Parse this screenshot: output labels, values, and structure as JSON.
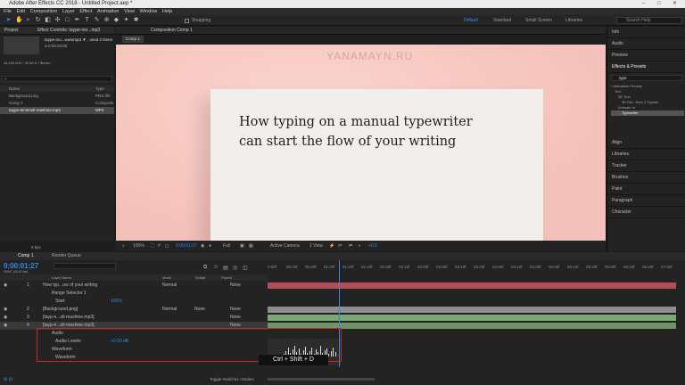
{
  "window": {
    "title": "Adobe After Effects CC 2018 - Untitled Project.aep *",
    "controls": [
      "–",
      "□",
      "✕"
    ]
  },
  "menu": [
    "File",
    "Edit",
    "Composition",
    "Layer",
    "Effect",
    "Animation",
    "View",
    "Window",
    "Help"
  ],
  "toolbar": {
    "snapping": "Snapping",
    "workspaces": [
      "Default",
      "Standard",
      "Small Screen",
      "Libraries"
    ],
    "help_placeholder": "Search Help"
  },
  "project": {
    "tab": "Project",
    "effect_controls": "Effect Controls: taype-mo...mp3",
    "selected_name": "taype-mo...wwwmp3 ▼ , used 2 times",
    "selected_dur": "Δ 0:00:03:00",
    "selected_info": "44,100 kHz / 32 bit U / Stereo",
    "search_placeholder": "",
    "name_header": "Name",
    "type_header": "Type",
    "items": [
      {
        "name": "Background.png",
        "type": "PNG file"
      },
      {
        "name": "Comp 1",
        "type": "Compositi"
      },
      {
        "name": "taype-tensmoll-mashine.mp3",
        "type": "MP3"
      }
    ],
    "bpc": "8 bpc"
  },
  "composition": {
    "tab": "Composition Comp 1",
    "subtab": "Comp 1",
    "watermark": "YANAMAYN.RU",
    "headline_line1": "How typing on a manual typewriter",
    "headline_line2": "can start the flow of your writing",
    "zoom": "100%",
    "timecode": "0:00:01:27",
    "resolution": "Full",
    "camera": "Active Camera",
    "view": "1 View",
    "offset": "+0.0"
  },
  "right_panels": {
    "items": [
      "Info",
      "Audio",
      "Preview",
      "Effects & Presets"
    ],
    "search_value": "type",
    "tree": [
      "* Animation Presets",
      "Text",
      "3D Text",
      "3D Rot...from Z Typewr",
      "Animate In",
      "Typewriter"
    ],
    "lower": [
      "Align",
      "Libraries",
      "Tracker",
      "Brushes",
      "Paint",
      "Paragraph",
      "Character"
    ]
  },
  "timeline": {
    "tab": "Comp 1",
    "render_queue": "Render Queue",
    "timecode": "0:00:01:27",
    "frame_info": "00047 (25.00 fps)",
    "headers": {
      "layer": "Layer Name",
      "mode": "Mode",
      "trkmat": "TrkMat",
      "parent": "Parent"
    },
    "ruler": [
      "0:00f",
      "00:10f",
      "00:20f",
      "01:00f",
      "01:10f",
      "01:20f",
      "02:00f",
      "02:10f",
      "02:20f",
      "03:00f",
      "03:10f",
      "03:20f",
      "04:00f",
      "04:10f",
      "04:20f",
      "05:00f",
      "05:10f",
      "05:20f",
      "06:00f",
      "06:10f",
      "06:20f",
      "07:00f"
    ],
    "layers": [
      {
        "num": "1",
        "name": "How typ...ow of your writing",
        "mode": "Normal",
        "parent": "None"
      },
      {
        "num": "",
        "name": "Range Selector 1",
        "mode": "",
        "parent": ""
      },
      {
        "num": "",
        "name": "Start",
        "mode": "",
        "parent": "",
        "value": "100%"
      },
      {
        "num": "2",
        "name": "[Background.png]",
        "mode": "Normal",
        "trk": "None",
        "parent": "None"
      },
      {
        "num": "3",
        "name": "[tayp-n...oll-mashine.mp3]",
        "mode": "",
        "parent": "None"
      },
      {
        "num": "4",
        "name": "[tayp-n...oll-mashine.mp3]",
        "mode": "",
        "parent": "None"
      },
      {
        "num": "",
        "name": "Audio",
        "mode": "",
        "parent": ""
      },
      {
        "num": "",
        "name": "Audio Levels",
        "mode": "",
        "parent": "",
        "value": "+0.00 dB"
      },
      {
        "num": "",
        "name": "Waveform",
        "mode": "",
        "parent": ""
      },
      {
        "num": "",
        "name": "Waveform",
        "mode": "",
        "parent": ""
      }
    ],
    "toggle": "Toggle Switches / Modes"
  },
  "keycast": "Ctrl + Shift + D"
}
